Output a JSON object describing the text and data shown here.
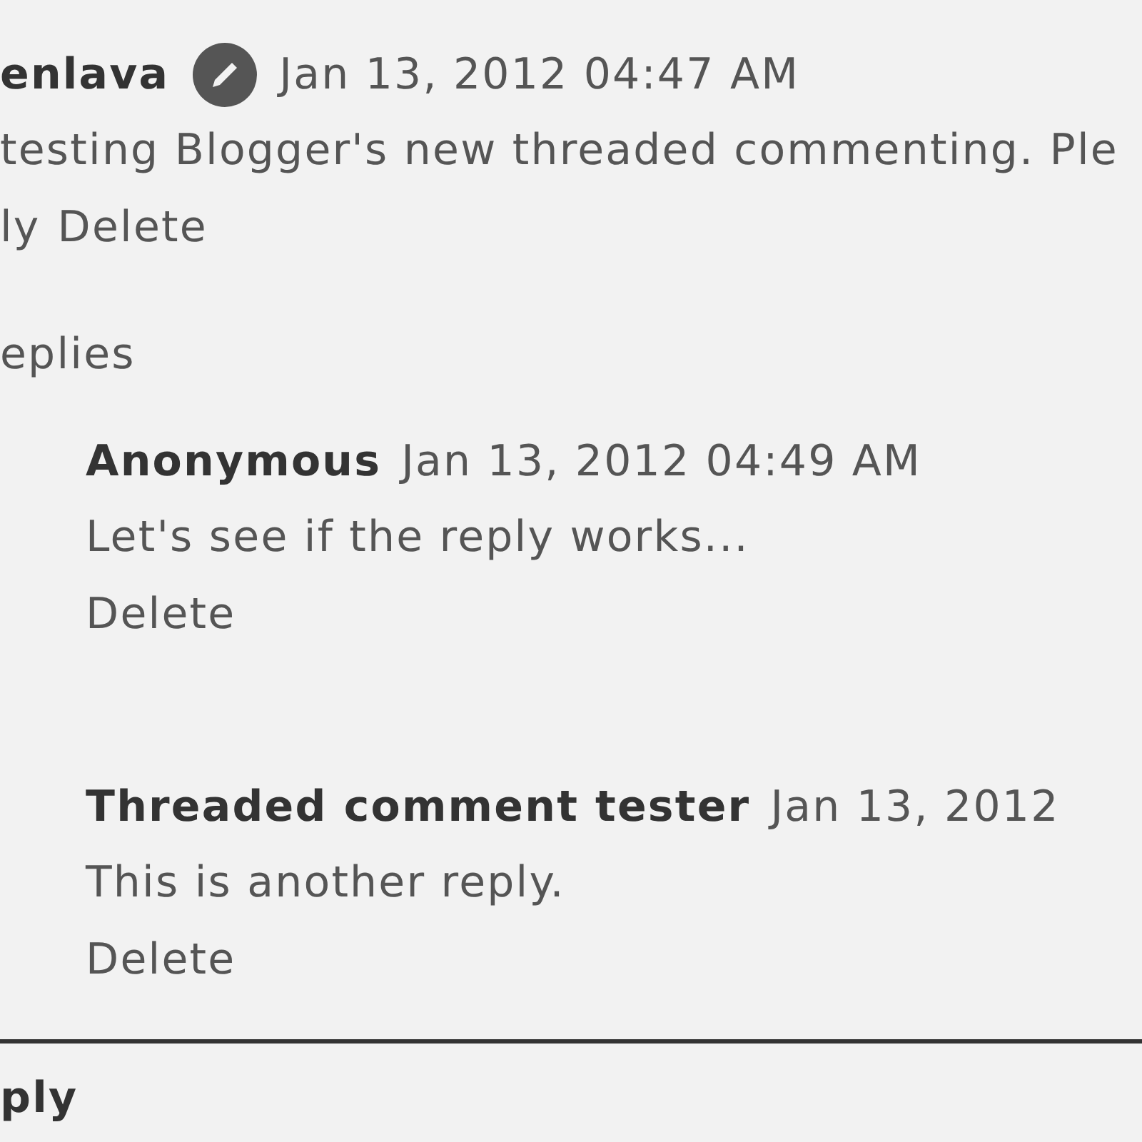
{
  "comment": {
    "author": "enlava",
    "timestamp": "Jan 13, 2012 04:47 AM",
    "text": "testing Blogger's new threaded commenting. Ple",
    "actions": [
      "ly",
      "Delete"
    ]
  },
  "replies_toggle": "eplies",
  "replies": [
    {
      "author": "Anonymous",
      "timestamp": "Jan 13, 2012 04:49 AM",
      "text": "Let's see if the reply works...",
      "actions": [
        "Delete"
      ]
    },
    {
      "author": "Threaded comment tester",
      "timestamp": "Jan 13, 2012",
      "text": "This is another reply.",
      "actions": [
        "Delete"
      ]
    }
  ],
  "reply_link": "ply"
}
